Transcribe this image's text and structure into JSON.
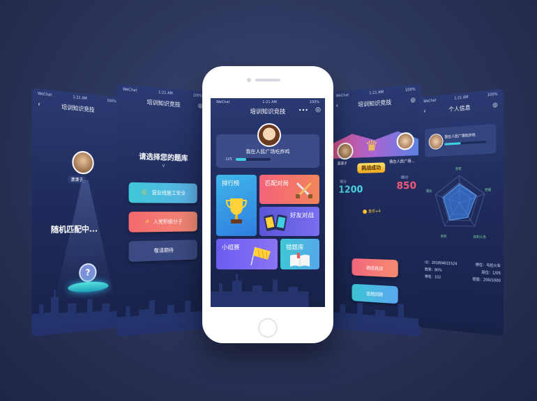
{
  "status": {
    "carrier": "WeChat",
    "time": "1:21 AM",
    "battery": "100%"
  },
  "app_title": "培训知识竞技",
  "screen1": {
    "title": "培训知识竞技",
    "user_name": "潇潇子",
    "matching_text": "随机匹配中...",
    "question_mark": "?"
  },
  "screen2": {
    "title": "培训知识竞技",
    "heading": "请选择您的题库",
    "options": [
      {
        "label": "营业线施工安全"
      },
      {
        "label": "入党积极分子"
      },
      {
        "label": "敬请期待"
      }
    ]
  },
  "center": {
    "user_name": "我在人民广场吃炸鸡",
    "level": "LV5",
    "level_progress": 0.3,
    "tiles": {
      "ranking": "排行榜",
      "match": "匹配对局",
      "friend": "好友对战",
      "group": "小组赛",
      "wrong": "错题库"
    }
  },
  "screen4": {
    "title": "培训知识竞技",
    "left_name": "潇潇子",
    "right_name": "我在人民广场...",
    "badge": "挑战成功",
    "score_label": "得分",
    "left_score": "1200",
    "right_score": "850",
    "coin": "金币+4",
    "btn_continue": "继续挑战",
    "btn_review": "答题回顾"
  },
  "screen5": {
    "title": "个人信息",
    "name": "我在人民广场吃炸鸡",
    "radar_labels": [
      "党史",
      "党规",
      "权利义务",
      "条例",
      "理论"
    ],
    "id_label": "ID：201804021524",
    "rank_label": "排位：马拉火车",
    "win_rate": "胜率：80%",
    "stars": "段位：1/05",
    "rank_no": "排名：102",
    "exp": "经验：200/1000"
  }
}
